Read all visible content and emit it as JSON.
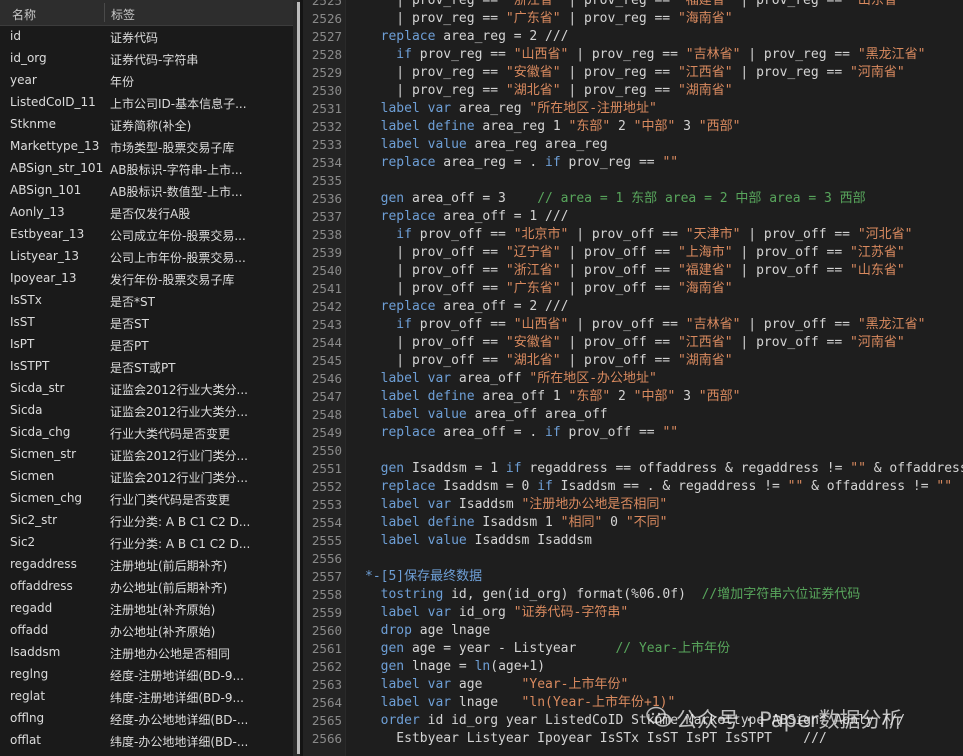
{
  "variables_panel": {
    "col_name": "名称",
    "col_label": "标签",
    "rows": [
      {
        "name": "id",
        "label": "证券代码"
      },
      {
        "name": "id_org",
        "label": "证券代码-字符串"
      },
      {
        "name": "year",
        "label": "年份"
      },
      {
        "name": "ListedCoID_11",
        "label": "上市公司ID-基本信息子..."
      },
      {
        "name": "Stknme",
        "label": "证券简称(补全)"
      },
      {
        "name": "Markettype_13",
        "label": "市场类型-股票交易子库"
      },
      {
        "name": "ABSign_str_101",
        "label": "AB股标识-字符串-上市..."
      },
      {
        "name": "ABSign_101",
        "label": "AB股标识-数值型-上市..."
      },
      {
        "name": "Aonly_13",
        "label": "是否仅发行A股"
      },
      {
        "name": "Estbyear_13",
        "label": "公司成立年份-股票交易..."
      },
      {
        "name": "Listyear_13",
        "label": "公司上市年份-股票交易..."
      },
      {
        "name": "Ipoyear_13",
        "label": "发行年份-股票交易子库"
      },
      {
        "name": "IsSTx",
        "label": "是否*ST"
      },
      {
        "name": "IsST",
        "label": "是否ST"
      },
      {
        "name": "IsPT",
        "label": "是否PT"
      },
      {
        "name": "IsSTPT",
        "label": "是否ST或PT"
      },
      {
        "name": "Sicda_str",
        "label": "证监会2012行业大类分..."
      },
      {
        "name": "Sicda",
        "label": "证监会2012行业大类分..."
      },
      {
        "name": "Sicda_chg",
        "label": "行业大类代码是否变更"
      },
      {
        "name": "Sicmen_str",
        "label": "证监会2012行业门类分..."
      },
      {
        "name": "Sicmen",
        "label": "证监会2012行业门类分..."
      },
      {
        "name": "Sicmen_chg",
        "label": "行业门类代码是否变更"
      },
      {
        "name": "Sic2_str",
        "label": "行业分类: A B C1 C2 D..."
      },
      {
        "name": "Sic2",
        "label": "行业分类: A B C1 C2 D..."
      },
      {
        "name": "regaddress",
        "label": "注册地址(前后期补齐)"
      },
      {
        "name": "offaddress",
        "label": "办公地址(前后期补齐)"
      },
      {
        "name": "regadd",
        "label": "注册地址(补齐原始)"
      },
      {
        "name": "offadd",
        "label": "办公地址(补齐原始)"
      },
      {
        "name": "Isaddsm",
        "label": "注册地办公地是否相同"
      },
      {
        "name": "reglng",
        "label": "经度-注册地详细(BD-9..."
      },
      {
        "name": "reglat",
        "label": "纬度-注册地详细(BD-9..."
      },
      {
        "name": "offlng",
        "label": "经度-办公地地详细(BD-..."
      },
      {
        "name": "offlat",
        "label": "纬度-办公地地详细(BD-..."
      }
    ]
  },
  "editor": {
    "line_numbers": [
      "2525",
      "2526",
      "2527",
      "2528",
      "2529",
      "2530",
      "2531",
      "2532",
      "2533",
      "2534",
      "2535",
      "2536",
      "2537",
      "2538",
      "2539",
      "2540",
      "2541",
      "2542",
      "2543",
      "2544",
      "2545",
      "2546",
      "2547",
      "2548",
      "2549",
      "2550",
      "2551",
      "2552",
      "2553",
      "2554",
      "2555",
      "2556",
      "2557",
      "2558",
      "2559",
      "2560",
      "2561",
      "2562",
      "2563",
      "2564",
      "2565",
      "2566"
    ],
    "code_lines": [
      [
        [
          "",
          "    | prov_reg == "
        ],
        [
          "str",
          "\"浙江省\""
        ],
        [
          "",
          " | prov_reg == "
        ],
        [
          "str",
          "\"福建省\""
        ],
        [
          "",
          " | prov_reg == "
        ],
        [
          "str",
          "\"山东省\""
        ]
      ],
      [
        [
          "",
          "    | prov_reg == "
        ],
        [
          "str",
          "\"广东省\""
        ],
        [
          "",
          " | prov_reg == "
        ],
        [
          "str",
          "\"海南省\""
        ]
      ],
      [
        [
          "kw",
          "  replace"
        ],
        [
          "",
          " area_reg = 2 ///"
        ]
      ],
      [
        [
          "kw",
          "    if"
        ],
        [
          "",
          " prov_reg == "
        ],
        [
          "str",
          "\"山西省\""
        ],
        [
          "",
          " | prov_reg == "
        ],
        [
          "str",
          "\"吉林省\""
        ],
        [
          "",
          " | prov_reg == "
        ],
        [
          "str",
          "\"黑龙江省\""
        ]
      ],
      [
        [
          "",
          "    | prov_reg == "
        ],
        [
          "str",
          "\"安徽省\""
        ],
        [
          "",
          " | prov_reg == "
        ],
        [
          "str",
          "\"江西省\""
        ],
        [
          "",
          " | prov_reg == "
        ],
        [
          "str",
          "\"河南省\""
        ]
      ],
      [
        [
          "",
          "    | prov_reg == "
        ],
        [
          "str",
          "\"湖北省\""
        ],
        [
          "",
          " | prov_reg == "
        ],
        [
          "str",
          "\"湖南省\""
        ]
      ],
      [
        [
          "kw",
          "  label var"
        ],
        [
          "",
          " area_reg "
        ],
        [
          "str",
          "\"所在地区-注册地址\""
        ]
      ],
      [
        [
          "kw",
          "  label define"
        ],
        [
          "",
          " area_reg 1 "
        ],
        [
          "str",
          "\"东部\""
        ],
        [
          "",
          " 2 "
        ],
        [
          "str",
          "\"中部\""
        ],
        [
          "",
          " 3 "
        ],
        [
          "str",
          "\"西部\""
        ]
      ],
      [
        [
          "kw",
          "  label value"
        ],
        [
          "",
          " area_reg area_reg"
        ]
      ],
      [
        [
          "kw",
          "  replace"
        ],
        [
          "",
          " area_reg = . "
        ],
        [
          "kw",
          "if"
        ],
        [
          "",
          " prov_reg == "
        ],
        [
          "str",
          "\"\""
        ]
      ],
      [
        [
          "",
          ""
        ]
      ],
      [
        [
          "kw",
          "  gen"
        ],
        [
          "",
          " area_off = 3    "
        ],
        [
          "cm",
          "// area = 1 东部 area = 2 中部 area = 3 西部"
        ]
      ],
      [
        [
          "kw",
          "  replace"
        ],
        [
          "",
          " area_off = 1 ///"
        ]
      ],
      [
        [
          "kw",
          "    if"
        ],
        [
          "",
          " prov_off == "
        ],
        [
          "str",
          "\"北京市\""
        ],
        [
          "",
          " | prov_off == "
        ],
        [
          "str",
          "\"天津市\""
        ],
        [
          "",
          " | prov_off == "
        ],
        [
          "str",
          "\"河北省\""
        ]
      ],
      [
        [
          "",
          "    | prov_off == "
        ],
        [
          "str",
          "\"辽宁省\""
        ],
        [
          "",
          " | prov_off == "
        ],
        [
          "str",
          "\"上海市\""
        ],
        [
          "",
          " | prov_off == "
        ],
        [
          "str",
          "\"江苏省\""
        ]
      ],
      [
        [
          "",
          "    | prov_off == "
        ],
        [
          "str",
          "\"浙江省\""
        ],
        [
          "",
          " | prov_off == "
        ],
        [
          "str",
          "\"福建省\""
        ],
        [
          "",
          " | prov_off == "
        ],
        [
          "str",
          "\"山东省\""
        ]
      ],
      [
        [
          "",
          "    | prov_off == "
        ],
        [
          "str",
          "\"广东省\""
        ],
        [
          "",
          " | prov_off == "
        ],
        [
          "str",
          "\"海南省\""
        ]
      ],
      [
        [
          "kw",
          "  replace"
        ],
        [
          "",
          " area_off = 2 ///"
        ]
      ],
      [
        [
          "kw",
          "    if"
        ],
        [
          "",
          " prov_off == "
        ],
        [
          "str",
          "\"山西省\""
        ],
        [
          "",
          " | prov_off == "
        ],
        [
          "str",
          "\"吉林省\""
        ],
        [
          "",
          " | prov_off == "
        ],
        [
          "str",
          "\"黑龙江省\""
        ]
      ],
      [
        [
          "",
          "    | prov_off == "
        ],
        [
          "str",
          "\"安徽省\""
        ],
        [
          "",
          " | prov_off == "
        ],
        [
          "str",
          "\"江西省\""
        ],
        [
          "",
          " | prov_off == "
        ],
        [
          "str",
          "\"河南省\""
        ]
      ],
      [
        [
          "",
          "    | prov_off == "
        ],
        [
          "str",
          "\"湖北省\""
        ],
        [
          "",
          " | prov_off == "
        ],
        [
          "str",
          "\"湖南省\""
        ]
      ],
      [
        [
          "kw",
          "  label var"
        ],
        [
          "",
          " area_off "
        ],
        [
          "str",
          "\"所在地区-办公地址\""
        ]
      ],
      [
        [
          "kw",
          "  label define"
        ],
        [
          "",
          " area_off 1 "
        ],
        [
          "str",
          "\"东部\""
        ],
        [
          "",
          " 2 "
        ],
        [
          "str",
          "\"中部\""
        ],
        [
          "",
          " 3 "
        ],
        [
          "str",
          "\"西部\""
        ]
      ],
      [
        [
          "kw",
          "  label value"
        ],
        [
          "",
          " area_off area_off"
        ]
      ],
      [
        [
          "kw",
          "  replace"
        ],
        [
          "",
          " area_off = . "
        ],
        [
          "kw",
          "if"
        ],
        [
          "",
          " prov_off == "
        ],
        [
          "str",
          "\"\""
        ]
      ],
      [
        [
          "",
          ""
        ]
      ],
      [
        [
          "kw",
          "  gen"
        ],
        [
          "",
          " Isaddsm = 1 "
        ],
        [
          "kw",
          "if"
        ],
        [
          "",
          " regaddress == offaddress & regaddress != "
        ],
        [
          "str",
          "\"\""
        ],
        [
          "",
          " & offaddress != "
        ],
        [
          "str",
          "\"\""
        ]
      ],
      [
        [
          "kw",
          "  replace"
        ],
        [
          "",
          " Isaddsm = 0 "
        ],
        [
          "kw",
          "if"
        ],
        [
          "",
          " Isaddsm == . & regaddress != "
        ],
        [
          "str",
          "\"\""
        ],
        [
          "",
          " & offaddress != "
        ],
        [
          "str",
          "\"\""
        ]
      ],
      [
        [
          "kw",
          "  label var"
        ],
        [
          "",
          " Isaddsm "
        ],
        [
          "str",
          "\"注册地办公地是否相同\""
        ]
      ],
      [
        [
          "kw",
          "  label define"
        ],
        [
          "",
          " Isaddsm 1 "
        ],
        [
          "str",
          "\"相同\""
        ],
        [
          "",
          " 0 "
        ],
        [
          "str",
          "\"不同\""
        ]
      ],
      [
        [
          "kw",
          "  label value"
        ],
        [
          "",
          " Isaddsm Isaddsm"
        ]
      ],
      [
        [
          "",
          ""
        ]
      ],
      [
        [
          "sec",
          "*-[5]保存最终数据"
        ]
      ],
      [
        [
          "kw",
          "  tostring"
        ],
        [
          "",
          " id, gen(id_org) format(%06.0f)  "
        ],
        [
          "cm",
          "//增加字符串六位证券代码"
        ]
      ],
      [
        [
          "kw",
          "  label var"
        ],
        [
          "",
          " id_org "
        ],
        [
          "str",
          "\"证券代码-字符串\""
        ]
      ],
      [
        [
          "kw",
          "  drop"
        ],
        [
          "",
          " age lnage"
        ]
      ],
      [
        [
          "kw",
          "  gen"
        ],
        [
          "",
          " age = year - Listyear     "
        ],
        [
          "cm",
          "// Year-上市年份"
        ]
      ],
      [
        [
          "kw",
          "  gen"
        ],
        [
          "",
          " lnage = "
        ],
        [
          "fn",
          "ln"
        ],
        [
          "",
          "(age+1)"
        ]
      ],
      [
        [
          "kw",
          "  label var"
        ],
        [
          "",
          " age     "
        ],
        [
          "str",
          "\"Year-上市年份\""
        ]
      ],
      [
        [
          "kw",
          "  label var"
        ],
        [
          "",
          " lnage   "
        ],
        [
          "str",
          "\"ln(Year-上市年份+1)\""
        ]
      ],
      [
        [
          "kw",
          "  order"
        ],
        [
          "",
          " id id_org year ListedCoID Stknme Markettype ABSign* Aonly ///"
        ]
      ],
      [
        [
          "",
          "    Estbyear Listyear Ipoyear IsSTx IsST IsPT IsSTPT    ///"
        ]
      ]
    ]
  },
  "watermark": {
    "text": "公众号 · Paper数据分析"
  },
  "colors": {
    "keyword": "#6e9fd6",
    "string": "#d98a5f",
    "comment": "#58a65c",
    "text": "#d4d4d4",
    "background": "#1e1e1e"
  }
}
